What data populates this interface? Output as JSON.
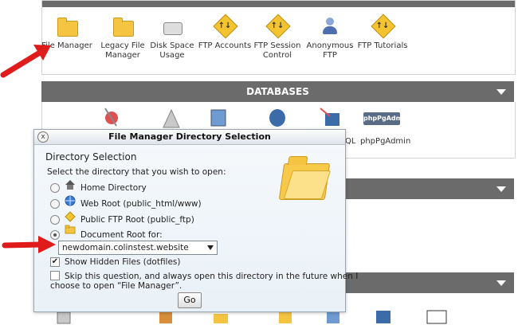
{
  "files_section": {
    "items": [
      {
        "label": "File Manager",
        "icon": "file-manager-folder-icon"
      },
      {
        "label": "Legacy File Manager",
        "icon": "legacy-file-manager-folder-icon"
      },
      {
        "label": "Disk Space Usage",
        "icon": "disk-space-usage-icon"
      },
      {
        "label": "FTP Accounts",
        "icon": "ftp-accounts-icon"
      },
      {
        "label": "FTP Session Control",
        "icon": "ftp-session-control-icon"
      },
      {
        "label": "Anonymous FTP",
        "icon": "anonymous-ftp-icon"
      },
      {
        "label": "FTP Tutorials",
        "icon": "ftp-tutorials-icon"
      }
    ]
  },
  "databases_section": {
    "title": "DATABASES",
    "partial_label": "QL",
    "pgadmin_logo_text": "phpPgAdmin",
    "pgadmin_label": "phpPgAdmin"
  },
  "dialog": {
    "title": "File Manager Directory Selection",
    "close": "x",
    "section_title": "Directory Selection",
    "prompt": "Select the directory that you wish to open:",
    "options": [
      {
        "label": "Home Directory",
        "selected": false,
        "icon": "home-icon"
      },
      {
        "label": "Web Root (public_html/www)",
        "selected": false,
        "icon": "globe-icon"
      },
      {
        "label": "Public FTP Root (public_ftp)",
        "selected": false,
        "icon": "ftp-icon"
      },
      {
        "label": "Document Root for:",
        "selected": true,
        "icon": "folder-icon"
      }
    ],
    "domain_select": "newdomain.colinstest.website",
    "show_hidden": {
      "label": "Show Hidden Files (dotfiles)",
      "checked": true
    },
    "skip": {
      "line1": "Skip this question, and always open this directory in the future when I",
      "line2": "choose to open “File Manager”.",
      "checked": false
    },
    "go_button": "Go"
  },
  "colors": {
    "section_header": "#6b6b6b",
    "arrow": "#e01b1b",
    "folder": "#f5c542"
  }
}
